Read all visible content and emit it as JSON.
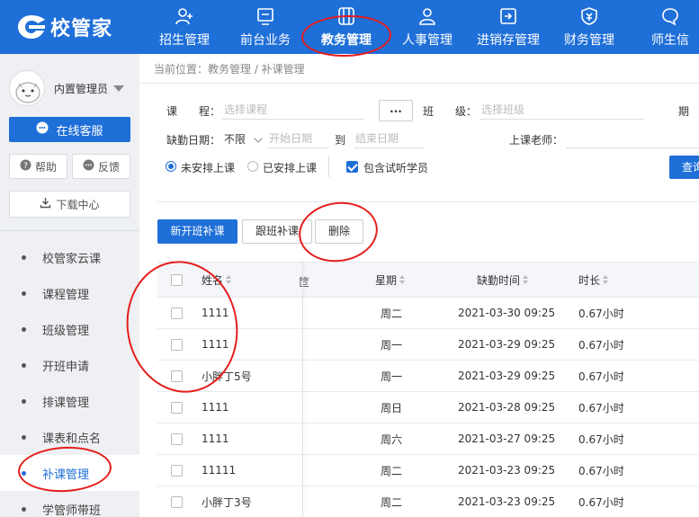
{
  "app": {
    "logo_text": "校管家"
  },
  "nav": [
    {
      "label": "招生管理",
      "icon": "add-user-icon"
    },
    {
      "label": "前台业务",
      "icon": "monitor-icon"
    },
    {
      "label": "教务管理",
      "icon": "book-icon",
      "active": true
    },
    {
      "label": "人事管理",
      "icon": "person-icon"
    },
    {
      "label": "进销存管理",
      "icon": "login-box-icon"
    },
    {
      "label": "财务管理",
      "icon": "money-shield-icon"
    },
    {
      "label": "师生信",
      "icon": "chat-icon"
    }
  ],
  "sidebar": {
    "user_name": "内置管理员",
    "service_label": "在线客服",
    "help_label": "帮助",
    "feedback_label": "反馈",
    "download_label": "下载中心",
    "menu": [
      {
        "label": "校管家云课"
      },
      {
        "label": "课程管理"
      },
      {
        "label": "班级管理"
      },
      {
        "label": "开班申请"
      },
      {
        "label": "排课管理"
      },
      {
        "label": "课表和点名"
      },
      {
        "label": "补课管理",
        "active": true
      },
      {
        "label": "学管师带班"
      }
    ]
  },
  "breadcrumb": "当前位置：教务管理 / 补课管理",
  "filters": {
    "course_label": "课　　程：",
    "course_placeholder": "选择课程",
    "dots_label": "...",
    "class_label": "班　　级：",
    "class_placeholder": "选择班级",
    "period_label_partial": "期",
    "absence_date_label": "缺勤日期：",
    "absence_range_value": "不限",
    "start_placeholder": "开始日期",
    "to_label": "到",
    "end_placeholder": "结束日期",
    "teacher_label": "上课老师：",
    "radio_unarranged": "未安排上课",
    "radio_arranged": "已安排上课",
    "include_trial": "包含试听学员",
    "search_label": "查询"
  },
  "actions": {
    "new_class_makeup": "新开班补课",
    "follow_class_makeup": "跟班补课",
    "delete": "删除"
  },
  "table": {
    "headers": {
      "name": "姓名",
      "hidden_fragment": "笸",
      "weekday": "星期",
      "absence_time": "缺勤时间",
      "duration": "时长"
    },
    "rows": [
      {
        "name": "1111",
        "weekday": "周二",
        "absence_time": "2021-03-30 09:25",
        "duration": "0.67小时"
      },
      {
        "name": "1111",
        "weekday": "周一",
        "absence_time": "2021-03-29 09:25",
        "duration": "0.67小时"
      },
      {
        "name": "小胖丁5号",
        "weekday": "周一",
        "absence_time": "2021-03-29 09:25",
        "duration": "0.67小时"
      },
      {
        "name": "1111",
        "weekday": "周日",
        "absence_time": "2021-03-28 09:25",
        "duration": "0.67小时"
      },
      {
        "name": "1111",
        "weekday": "周六",
        "absence_time": "2021-03-27 09:25",
        "duration": "0.67小时"
      },
      {
        "name": "11111",
        "weekday": "周二",
        "absence_time": "2021-03-23 09:25",
        "duration": "0.67小时"
      },
      {
        "name": "小胖丁3号",
        "weekday": "周二",
        "absence_time": "2021-03-23 09:25",
        "duration": "0.67小时"
      }
    ]
  },
  "colors": {
    "brand": "#1f6fd8",
    "annotation": "#e51d1d"
  }
}
